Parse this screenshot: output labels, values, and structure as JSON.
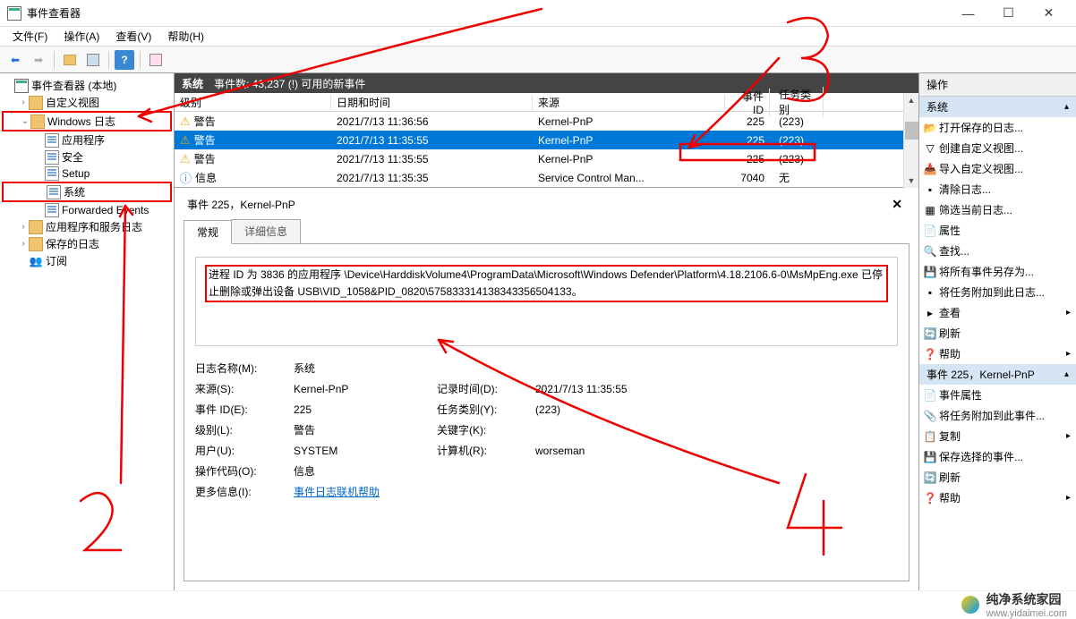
{
  "window": {
    "title": "事件查看器",
    "controls": {
      "min": "—",
      "max": "☐",
      "close": "✕"
    }
  },
  "menu": {
    "file": "文件(F)",
    "action": "操作(A)",
    "view": "查看(V)",
    "help": "帮助(H)"
  },
  "tree": {
    "root": "事件查看器 (本地)",
    "custom": "自定义视图",
    "winlogs": "Windows 日志",
    "app": "应用程序",
    "security": "安全",
    "setup": "Setup",
    "system": "系统",
    "forwarded": "Forwarded Events",
    "appsvc": "应用程序和服务日志",
    "saved": "保存的日志",
    "subs": "订阅"
  },
  "list": {
    "title": "系统",
    "count": "事件数: 43,237 (!) 可用的新事件",
    "cols": {
      "level": "级别",
      "date": "日期和时间",
      "source": "来源",
      "id": "事件 ID",
      "task": "任务类别"
    },
    "rows": [
      {
        "icon": "warn",
        "level": "警告",
        "date": "2021/7/13 11:36:56",
        "src": "Kernel-PnP",
        "id": "225",
        "task": "(223)"
      },
      {
        "icon": "warn",
        "level": "警告",
        "date": "2021/7/13 11:35:55",
        "src": "Kernel-PnP",
        "id": "225",
        "task": "(223)",
        "selected": true
      },
      {
        "icon": "warn",
        "level": "警告",
        "date": "2021/7/13 11:35:55",
        "src": "Kernel-PnP",
        "id": "225",
        "task": "(223)"
      },
      {
        "icon": "info",
        "level": "信息",
        "date": "2021/7/13 11:35:35",
        "src": "Service Control Man...",
        "id": "7040",
        "task": "无"
      }
    ]
  },
  "detail": {
    "header": "事件 225，Kernel-PnP",
    "tab_general": "常规",
    "tab_details": "详细信息",
    "description": "进程 ID 为 3836 的应用程序 \\Device\\HarddiskVolume4\\ProgramData\\Microsoft\\Windows Defender\\Platform\\4.18.2106.6-0\\MsMpEng.exe 已停止删除或弹出设备 USB\\VID_1058&PID_0820\\575833314138343356504133。",
    "labels": {
      "logname": "日志名称(M):",
      "logname_v": "系统",
      "source": "来源(S):",
      "source_v": "Kernel-PnP",
      "logged": "记录时间(D):",
      "logged_v": "2021/7/13 11:35:55",
      "eventid": "事件 ID(E):",
      "eventid_v": "225",
      "taskcat": "任务类别(Y):",
      "taskcat_v": "(223)",
      "level": "级别(L):",
      "level_v": "警告",
      "keywords": "关键字(K):",
      "keywords_v": "",
      "user": "用户(U):",
      "user_v": "SYSTEM",
      "computer": "计算机(R):",
      "computer_v": "worseman",
      "opcode": "操作代码(O):",
      "opcode_v": "信息",
      "moreinfo": "更多信息(I):",
      "moreinfo_link": "事件日志联机帮助"
    }
  },
  "actions": {
    "title": "操作",
    "section1": "系统",
    "items1": [
      "打开保存的日志...",
      "创建自定义视图...",
      "导入自定义视图...",
      "清除日志...",
      "筛选当前日志...",
      "属性",
      "查找...",
      "将所有事件另存为...",
      "将任务附加到此日志...",
      "查看",
      "刷新",
      "帮助"
    ],
    "section2": "事件 225，Kernel-PnP",
    "items2": [
      "事件属性",
      "将任务附加到此事件...",
      "复制",
      "保存选择的事件...",
      "刷新",
      "帮助"
    ]
  },
  "footer": {
    "brand": "纯净系统家园",
    "url": "www.yidaimei.com"
  }
}
